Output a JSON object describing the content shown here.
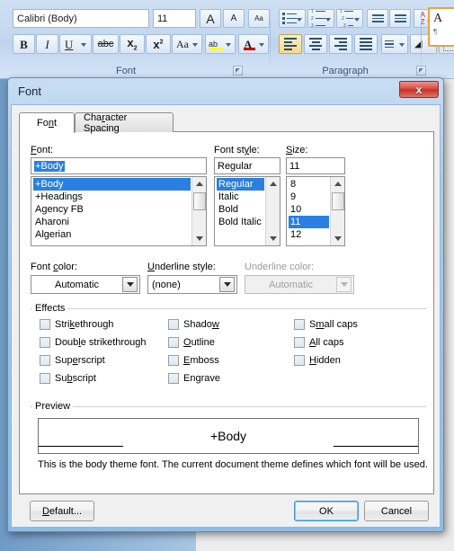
{
  "ribbon": {
    "groups": [
      {
        "name": "Font",
        "label": "Font"
      },
      {
        "name": "Paragraph",
        "label": "Paragraph"
      }
    ],
    "font_group": {
      "font_name_value": "Calibri (Body)",
      "font_size_value": "11",
      "grow_font_label": "A",
      "shrink_font_label": "A",
      "clear_formatting_label": "Aa",
      "bold_label": "B",
      "italic_label": "I",
      "underline_label": "U",
      "strikethrough_label": "abc",
      "subscript_label": "x",
      "subscript_sub": "2",
      "superscript_label": "x",
      "superscript_sup": "2",
      "change_case_label": "Aa",
      "highlight_label": "ab",
      "highlight_color": "#ffff00",
      "font_color_label": "A",
      "font_color": "#cc0000"
    }
  },
  "dialog": {
    "title": "Font",
    "close_label": "x",
    "tabs": [
      {
        "label": "Font",
        "accel_index": 2,
        "selected": true
      },
      {
        "label": "Character Spacing",
        "accel_index": 4,
        "selected": false
      }
    ],
    "font_section": {
      "font_label": "Font:",
      "font_label_accel": "F",
      "font_value": "+Body",
      "font_options": [
        "+Body",
        "+Headings",
        "Agency FB",
        "Aharoni",
        "Algerian"
      ],
      "font_selected_index": 0,
      "style_label": "Font style:",
      "style_label_accel": "y",
      "style_value": "Regular",
      "style_options": [
        "Regular",
        "Italic",
        "Bold",
        "Bold Italic"
      ],
      "style_selected_index": 0,
      "size_label": "Size:",
      "size_label_accel": "S",
      "size_value": "11",
      "size_options": [
        "8",
        "9",
        "10",
        "11",
        "12"
      ],
      "size_selected_index": 3
    },
    "color_row": {
      "font_color_label": "Font color:",
      "font_color_value": "Automatic",
      "underline_style_label": "Underline style:",
      "underline_style_value": "(none)",
      "underline_color_label": "Underline color:",
      "underline_color_value": "Automatic",
      "underline_color_disabled": true
    },
    "effects": {
      "title": "Effects",
      "column1": [
        {
          "label": "Strikethrough",
          "checked": false
        },
        {
          "label": "Double strikethrough",
          "checked": false
        },
        {
          "label": "Superscript",
          "checked": false
        },
        {
          "label": "Subscript",
          "checked": false
        }
      ],
      "column2": [
        {
          "label": "Shadow",
          "checked": false
        },
        {
          "label": "Outline",
          "checked": false
        },
        {
          "label": "Emboss",
          "checked": false
        },
        {
          "label": "Engrave",
          "checked": false
        }
      ],
      "column3": [
        {
          "label": "Small caps",
          "checked": false
        },
        {
          "label": "All caps",
          "checked": false
        },
        {
          "label": "Hidden",
          "checked": false
        }
      ]
    },
    "preview": {
      "title": "Preview",
      "sample_text": "+Body",
      "description": "This is the body theme font. The current document theme defines which font will be used."
    },
    "buttons": {
      "default_label": "Default...",
      "ok_label": "OK",
      "cancel_label": "Cancel"
    }
  }
}
